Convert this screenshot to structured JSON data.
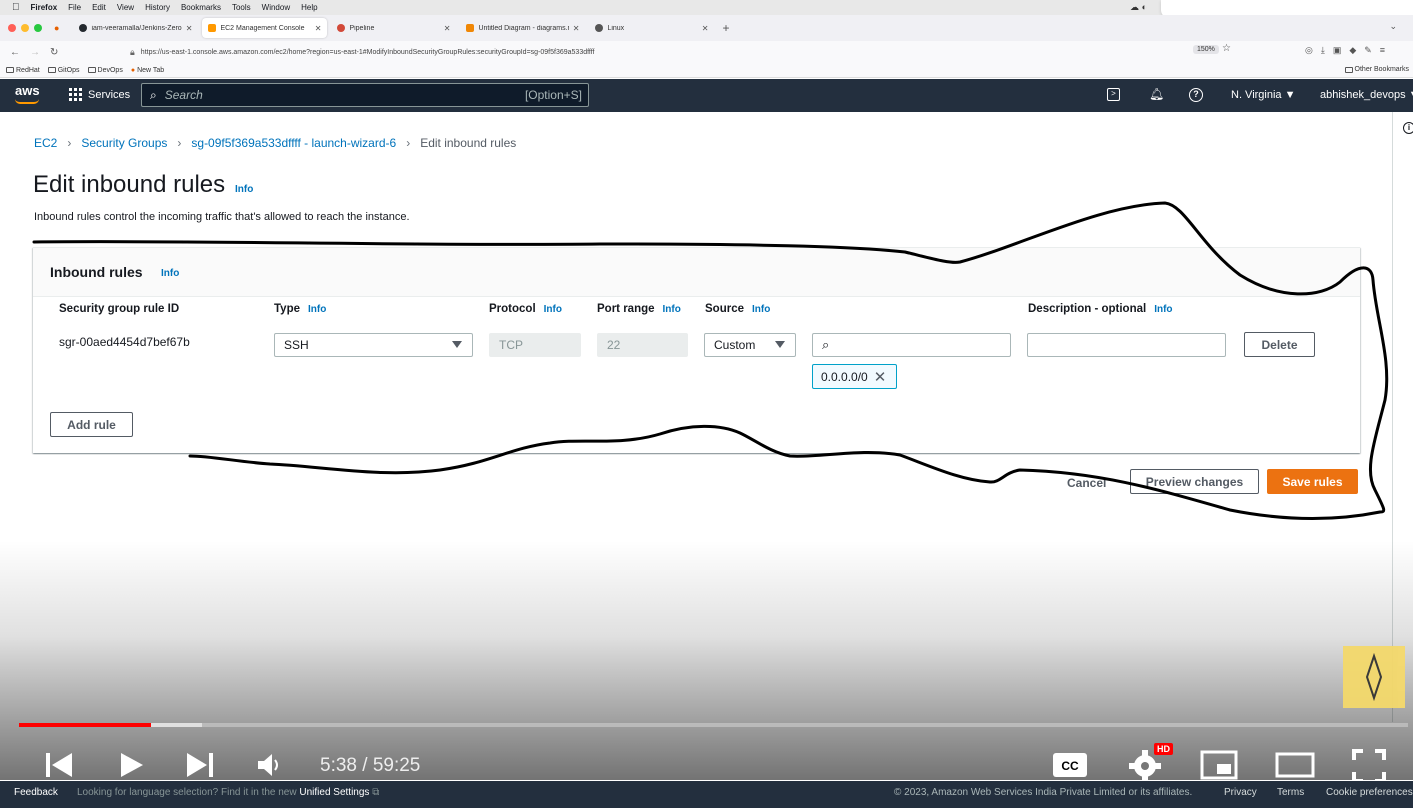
{
  "mac_menubar": {
    "items": [
      "Firefox",
      "File",
      "Edit",
      "View",
      "History",
      "Bookmarks",
      "Tools",
      "Window",
      "Help"
    ]
  },
  "browser": {
    "tabs": [
      {
        "label": "iam-veeramalla/Jenkins-Zero-T",
        "favicon_color": "#24292f",
        "active": false
      },
      {
        "label": "EC2 Management Console",
        "favicon_color": "#ff9900",
        "active": true
      },
      {
        "label": "Pipeline",
        "favicon_color": "#d24939",
        "active": false
      },
      {
        "label": "Untitled Diagram - diagrams.net",
        "favicon_color": "#f08705",
        "active": false
      },
      {
        "label": "Linux",
        "favicon_color": "#555555",
        "active": false
      }
    ],
    "url": "https://us-east-1.console.aws.amazon.com/ec2/home?region=us-east-1#ModifyInboundSecurityGroupRules:securityGroupId=sg-09f5f369a533dffff",
    "zoom": "150%",
    "bookmarks": [
      "RedHat",
      "GitOps",
      "DevOps",
      "New Tab"
    ],
    "bookmarks_right": "Other Bookmarks"
  },
  "aws_nav": {
    "logo": "aws",
    "services_label": "Services",
    "search_placeholder": "Search",
    "search_shortcut": "[Option+S]",
    "region": "N. Virginia",
    "user": "abhishek_devops"
  },
  "breadcrumb": {
    "items": [
      "EC2",
      "Security Groups",
      "sg-09f5f369a533dffff - launch-wizard-6"
    ],
    "current": "Edit inbound rules"
  },
  "page": {
    "title": "Edit inbound rules",
    "info": "Info",
    "description": "Inbound rules control the incoming traffic that's allowed to reach the instance."
  },
  "panel": {
    "title": "Inbound rules",
    "info": "Info",
    "columns": {
      "rule_id": "Security group rule ID",
      "type": "Type",
      "protocol": "Protocol",
      "port_range": "Port range",
      "source": "Source",
      "description": "Description - optional"
    },
    "rule": {
      "id": "sgr-00aed4454d7bef67b",
      "type": "SSH",
      "protocol": "TCP",
      "port": "22",
      "source_mode": "Custom",
      "source_token": "0.0.0.0/0",
      "description": ""
    },
    "delete_label": "Delete",
    "add_rule_label": "Add rule"
  },
  "actions": {
    "cancel": "Cancel",
    "preview": "Preview changes",
    "save": "Save rules",
    "save_color": "#ec7211"
  },
  "video": {
    "time_current": "5:38",
    "time_total": "59:25",
    "time_text": "5:38 / 59:25",
    "progress_fraction": 0.095,
    "buffered_fraction": 0.132,
    "hd_badge": "HD",
    "progress_color": "#ff0000"
  },
  "aws_footer": {
    "feedback": "Feedback",
    "lang_prefix": "Looking for language selection? Find it in the new",
    "lang_link": "Unified Settings",
    "copyright": "© 2023, Amazon Web Services India Private Limited or its affiliates.",
    "privacy": "Privacy",
    "terms": "Terms",
    "cookies": "Cookie preferences"
  }
}
